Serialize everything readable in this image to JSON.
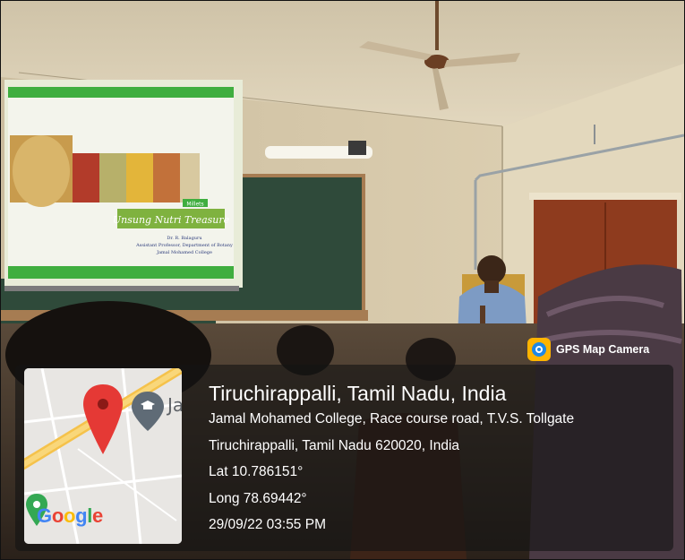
{
  "badge": {
    "app_name": "GPS Map Camera",
    "icon": "gps-camera-app-icon"
  },
  "map": {
    "logo_text": "Google",
    "partial_label": "Ja",
    "pin_icon": "location-pin-icon",
    "place_icon": "graduation-cap-icon"
  },
  "location": {
    "title": "Tiruchirappalli, Tamil Nadu, India",
    "address_line1": "Jamal Mohamed College, Race course road, T.V.S. Tollgate",
    "address_line2": "Tiruchirappalli, Tamil Nadu 620020, India",
    "latitude": "Lat 10.786151°",
    "longitude": "Long 78.69442°",
    "timestamp": "29/09/22 03:55 PM"
  },
  "slide": {
    "title": "Unsung Nutri Treasure",
    "tag": "Millets",
    "presenter": "Dr. R. Balaguru",
    "affiliation_line1": "Assistant Professor, Department of Botany",
    "affiliation_line2": "Jamal Mohamed College"
  },
  "colors": {
    "panel_bg": "#141414",
    "pin_red": "#e53935",
    "map_road": "#f5c24b",
    "slide_green": "#3fae3f"
  }
}
